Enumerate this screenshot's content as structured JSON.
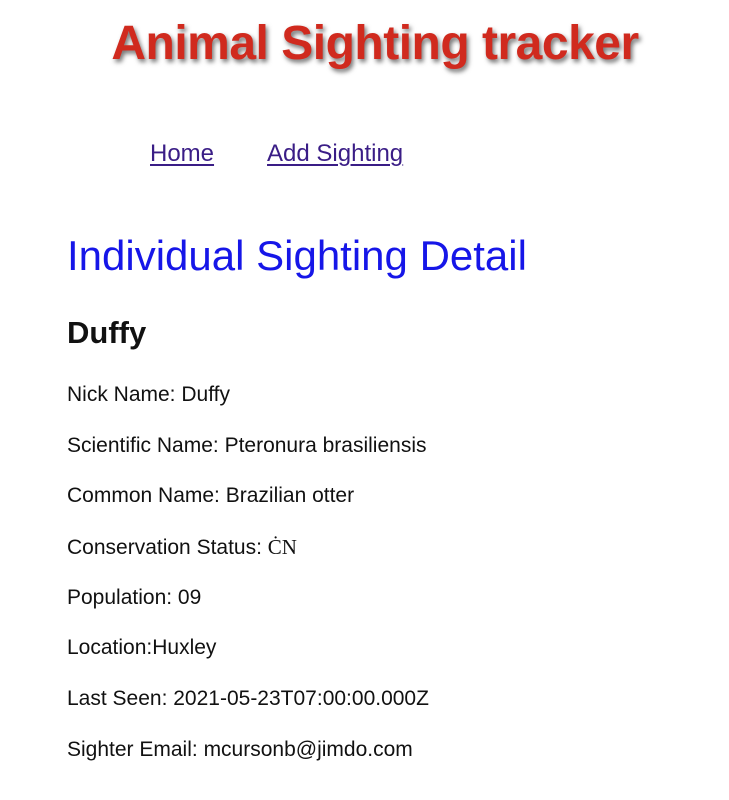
{
  "app": {
    "title": "Animal Sighting tracker"
  },
  "nav": {
    "home_label": "Home",
    "add_sighting_label": "Add Sighting"
  },
  "page": {
    "heading": "Individual Sighting Detail"
  },
  "sighting": {
    "name": "Duffy",
    "nick_name": {
      "label": "Nick Name: ",
      "value": "Duffy"
    },
    "scientific_name": {
      "label": "Scientific Name: ",
      "value": "Pteronura brasiliensis"
    },
    "common_name": {
      "label": "Common Name: ",
      "value": "Brazilian otter"
    },
    "conservation_status": {
      "label": "Conservation Status: ",
      "value": "ĊN"
    },
    "population": {
      "label": "Population: ",
      "value": "09"
    },
    "location": {
      "label": "Location:",
      "value": "Huxley"
    },
    "last_seen": {
      "label": "Last Seen: ",
      "value": "2021-05-23T07:00:00.000Z"
    },
    "sighter_email": {
      "label": "Sighter Email: ",
      "value": "mcursonb@jimdo.com"
    }
  },
  "colors": {
    "title": "#d02a1e",
    "nav_link": "#3a1d86",
    "heading": "#1616e8",
    "text": "#111111"
  }
}
